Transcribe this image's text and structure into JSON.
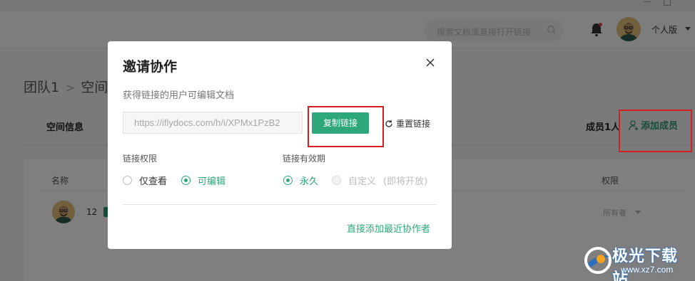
{
  "header": {
    "search_placeholder": "搜索文档或直接打开链接",
    "edition": "个人版"
  },
  "page": {
    "breadcrumb": [
      "团队1",
      "空间设"
    ],
    "space_info": "空间信息",
    "members_count": "成员1人",
    "add_member": "添加成员",
    "table": {
      "col_name": "名称",
      "col_permission": "权限",
      "rows": [
        {
          "name": "12",
          "role": "所有者"
        }
      ]
    }
  },
  "modal": {
    "title": "邀请协作",
    "subtitle": "获得链接的用户可编辑文档",
    "link_value": "https://iflydocs.com/h/i/XPMx1PzB2",
    "copy_button": "复制链接",
    "reset_link": "重置链接",
    "permission_label": "链接权限",
    "permission_options": [
      {
        "label": "仅查看",
        "selected": false
      },
      {
        "label": "可编辑",
        "selected": true
      }
    ],
    "expiry_label": "链接有效期",
    "expiry_options": [
      {
        "label": "永久",
        "selected": true
      },
      {
        "label": "自定义",
        "selected": false,
        "note": "(即将开放)"
      }
    ],
    "recent_link": "直接添加最近协作者"
  },
  "colors": {
    "accent": "#2ea87a",
    "highlight": "#d21f1f"
  },
  "watermark": {
    "title": "极光下载站",
    "url": "www.xz7.com"
  }
}
